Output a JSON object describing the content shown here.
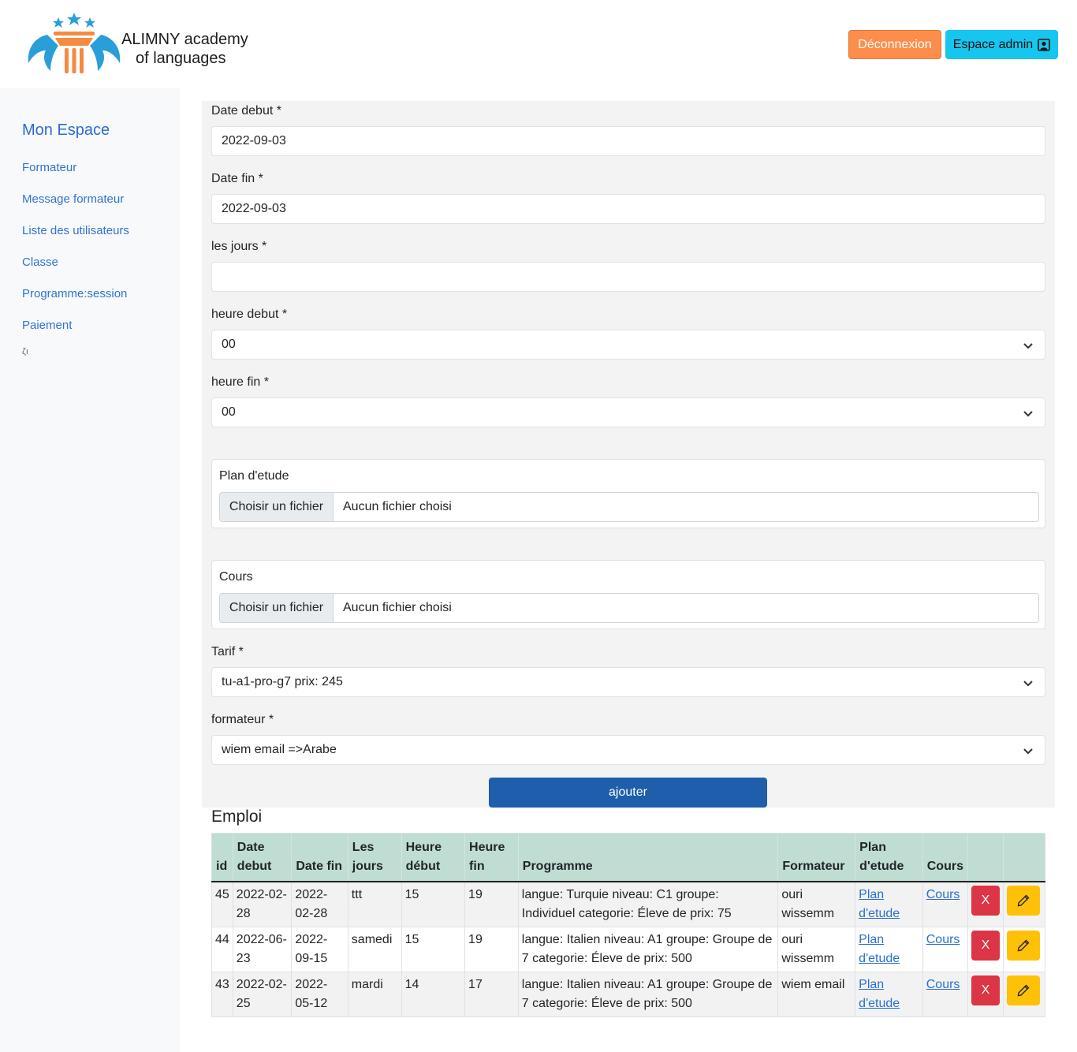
{
  "header": {
    "logo_line1": "ALIMNY academy",
    "logo_line2": "of languages",
    "logout_label": "Déconnexion",
    "admin_label": "Espace admin"
  },
  "sidebar": {
    "title": "Mon Espace",
    "items": [
      {
        "label": "Formateur"
      },
      {
        "label": "Message formateur"
      },
      {
        "label": "Liste des utilisateurs"
      },
      {
        "label": "Classe"
      },
      {
        "label": "Programme:session"
      },
      {
        "label": "Paiement"
      }
    ],
    "tail": "ζı"
  },
  "form": {
    "date_debut_label": "Date debut *",
    "date_debut_value": "2022-09-03",
    "date_fin_label": "Date fin *",
    "date_fin_value": "2022-09-03",
    "jours_label": "les jours *",
    "jours_value": "",
    "heure_debut_label": "heure debut *",
    "heure_debut_value": "00",
    "heure_fin_label": "heure fin *",
    "heure_fin_value": "00",
    "plan_label": "Plan d'etude",
    "cours_label": "Cours",
    "file_button": "Choisir un fichier",
    "file_none": "Aucun fichier choisi",
    "tarif_label": "Tarif *",
    "tarif_value": "tu-a1-pro-g7 prix: 245",
    "formateur_label": "formateur *",
    "formateur_value": "wiem email =>Arabe",
    "submit_label": "ajouter"
  },
  "emploi": {
    "title": "Emploi",
    "headers": [
      "id",
      "Date debut",
      "Date fin",
      "Les jours",
      "Heure début",
      "Heure fin",
      "Programme",
      "Formateur",
      "Plan d'etude",
      "Cours",
      "",
      ""
    ],
    "rows": [
      {
        "id": "45",
        "date_debut": "2022-02-28",
        "date_fin": "2022-02-28",
        "jours": "ttt",
        "heure_debut": "15",
        "heure_fin": "19",
        "programme": "langue: Turquie niveau: C1 groupe: Individuel categorie: Éleve de prix: 75",
        "formateur": "ouri wissemm",
        "plan": "Plan d'etude",
        "cours": "Cours",
        "delete": "X"
      },
      {
        "id": "44",
        "date_debut": "2022-06-23",
        "date_fin": "2022-09-15",
        "jours": "samedi",
        "heure_debut": "15",
        "heure_fin": "19",
        "programme": "langue: Italien niveau: A1 groupe: Groupe de 7 categorie: Éleve de prix: 500",
        "formateur": "ouri wissemm",
        "plan": "Plan d'etude",
        "cours": "Cours",
        "delete": "X"
      },
      {
        "id": "43",
        "date_debut": "2022-02-25",
        "date_fin": "2022-05-12",
        "jours": "mardi",
        "heure_debut": "14",
        "heure_fin": "17",
        "programme": "langue: Italien niveau: A1 groupe: Groupe de 7 categorie: Éleve de prix: 500",
        "formateur": "wiem email",
        "plan": "Plan d'etude",
        "cours": "Cours",
        "delete": "X"
      }
    ]
  },
  "colors": {
    "logout": "#fd8d4b",
    "admin": "#16c6ee",
    "submit": "#1e5eaa",
    "delete": "#dc3545",
    "edit": "#ffc107",
    "table_header": "#c0ddd3",
    "sidebar_link": "#2f74d1"
  },
  "icons": {
    "admin": "user-square-icon",
    "select": "chevron-down-icon",
    "edit": "pencil-icon",
    "logo": "pillar-stars-logo"
  }
}
